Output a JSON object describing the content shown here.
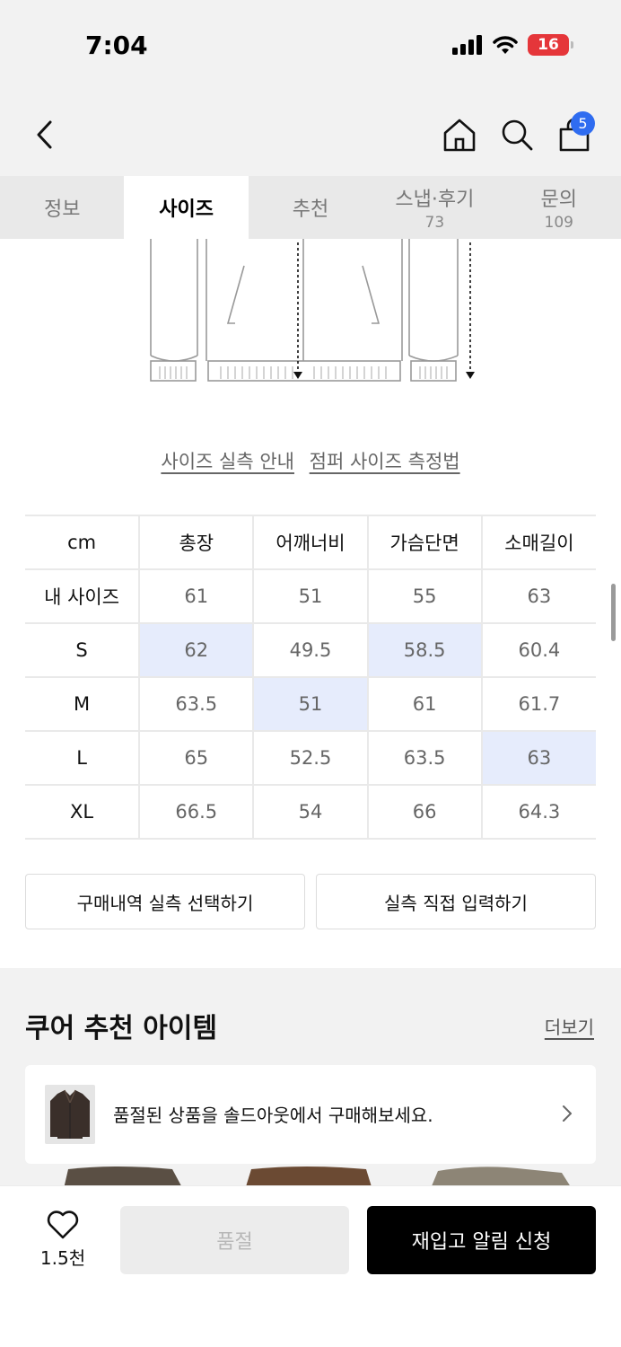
{
  "status": {
    "time": "7:04",
    "battery": "16"
  },
  "nav": {
    "cart_count": "5"
  },
  "tabs": [
    {
      "label": "정보",
      "count": ""
    },
    {
      "label": "사이즈",
      "count": ""
    },
    {
      "label": "추천",
      "count": ""
    },
    {
      "label": "스냅·후기",
      "count": "73"
    },
    {
      "label": "문의",
      "count": "109"
    }
  ],
  "guide": {
    "size_guide": "사이즈 실측 안내",
    "measure_guide": "점퍼 사이즈 측정법"
  },
  "size_table": {
    "unit": "cm",
    "columns": [
      "총장",
      "어깨너비",
      "가슴단면",
      "소매길이"
    ],
    "rows": [
      {
        "label": "내 사이즈",
        "values": [
          "61",
          "51",
          "55",
          "63"
        ]
      },
      {
        "label": "S",
        "values": [
          "62",
          "49.5",
          "58.5",
          "60.4"
        ]
      },
      {
        "label": "M",
        "values": [
          "63.5",
          "51",
          "61",
          "61.7"
        ]
      },
      {
        "label": "L",
        "values": [
          "65",
          "52.5",
          "63.5",
          "63"
        ]
      },
      {
        "label": "XL",
        "values": [
          "66.5",
          "54",
          "66",
          "64.3"
        ]
      }
    ]
  },
  "actions": {
    "purchase_history": "구매내역 실측 선택하기",
    "manual_input": "실측 직접 입력하기"
  },
  "recommend": {
    "title": "쿠어 추천 아이템",
    "more": "더보기",
    "soldout_banner": "품절된 상품을 솔드아웃에서 구매해보세요."
  },
  "bottom": {
    "like_count": "1.5천",
    "soldout": "품절",
    "restock": "재입고 알림 신청"
  },
  "colors": {
    "accent": "#2f6cf0",
    "highlight": "#e6ecfc"
  }
}
